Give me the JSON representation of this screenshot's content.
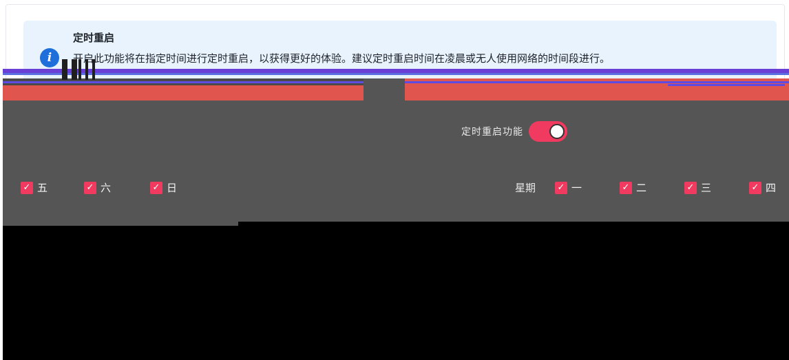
{
  "notice": {
    "title": "定时重启",
    "icon": "info-icon",
    "text": "开启此功能将在指定时间进行定时重启，以获得更好的体验。建议定时重启时间在凌晨或无人使用网络的时间段进行。"
  },
  "toggle": {
    "label": "定时重启功能",
    "on": true
  },
  "schedule": {
    "prefix": "星期",
    "days": [
      {
        "label": "一",
        "checked": true
      },
      {
        "label": "二",
        "checked": true
      },
      {
        "label": "三",
        "checked": true
      },
      {
        "label": "四",
        "checked": true
      },
      {
        "label": "五",
        "checked": true
      },
      {
        "label": "六",
        "checked": true
      },
      {
        "label": "日",
        "checked": true
      }
    ]
  },
  "colors": {
    "accent": "#f03a5f",
    "info_bg": "#e8f3fd",
    "info_icon": "#1e6fd9"
  }
}
